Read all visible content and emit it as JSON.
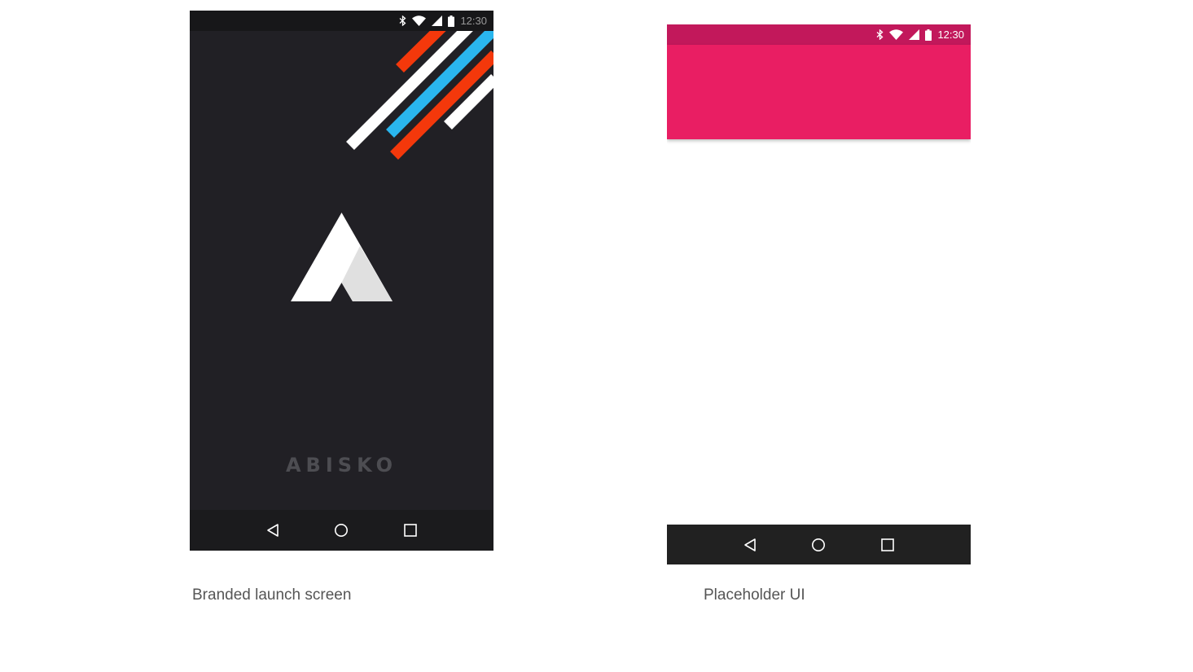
{
  "screens": [
    {
      "caption": "Branded launch screen",
      "status_time": "12:30",
      "brand_word": "ABISKO",
      "colors": {
        "background": "#212025",
        "status_bar": "#171719",
        "stripe_red": "#f4380b",
        "stripe_blue": "#2ab6ee",
        "stripe_white": "#ffffff"
      }
    },
    {
      "caption": "Placeholder UI",
      "status_time": "12:30",
      "colors": {
        "status_bar": "#c2185b",
        "app_bar": "#e91e63",
        "nav_bar": "#212121"
      }
    }
  ],
  "icons": {
    "status": [
      "bluetooth-icon",
      "wifi-icon",
      "cell-signal-icon",
      "battery-icon"
    ],
    "nav": [
      "back-icon",
      "home-icon",
      "recents-icon"
    ]
  }
}
